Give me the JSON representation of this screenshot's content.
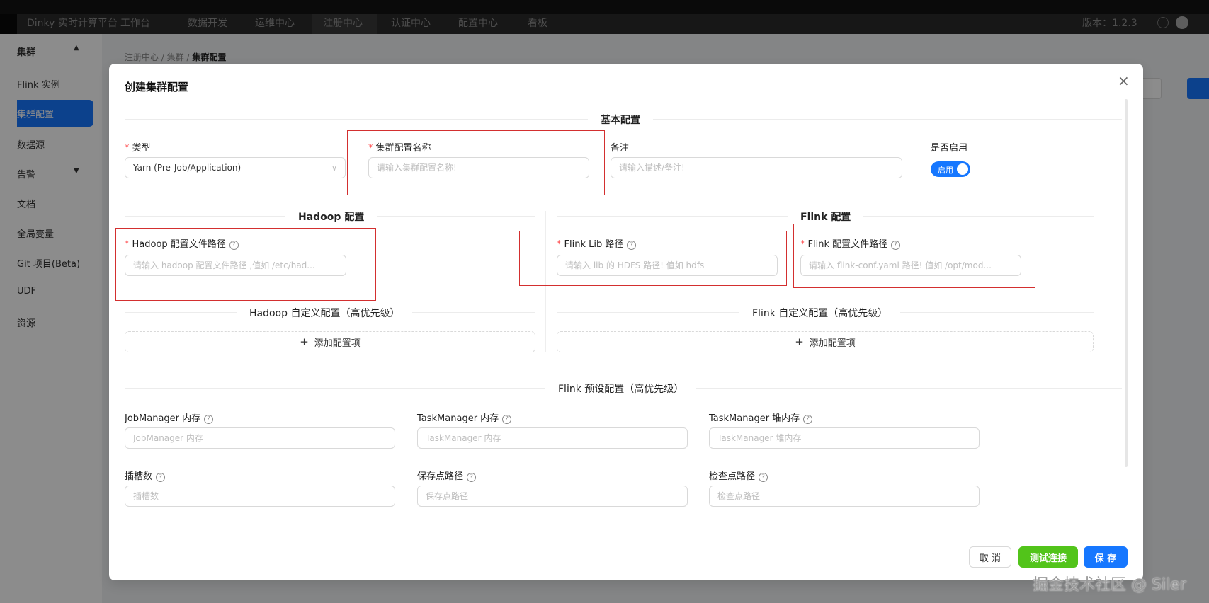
{
  "app": {
    "title": "Dinky 实时计算平台",
    "nav": [
      "工作台",
      "数据开发",
      "运维中心",
      "注册中心",
      "认证中心",
      "配置中心",
      "看板"
    ],
    "active_nav": "注册中心",
    "version": "版本：1.2.3"
  },
  "sidebar": {
    "group": "集群",
    "items": [
      "Flink 实例",
      "集群配置",
      "数据源",
      "告警",
      "文档",
      "全局变量",
      "Git 项目(Beta)",
      "UDF",
      "资源"
    ],
    "active": "集群配置"
  },
  "breadcrumb": [
    "注册中心",
    "集群",
    "集群配置"
  ],
  "modal": {
    "title": "创建集群配置",
    "sections": {
      "basic": "基本配置",
      "hadoop": "Hadoop 配置",
      "flink": "Flink 配置",
      "hadoop_custom": "Hadoop 自定义配置（高优先级）",
      "flink_custom": "Flink 自定义配置（高优先级）",
      "flink_preset": "Flink 预设配置（高优先级）"
    },
    "basic": {
      "type_label": "类型",
      "type_value_prefix": "Yarn (",
      "type_value_strike": "Pre-Job",
      "type_value_suffix": "/Application)",
      "name_label": "集群配置名称",
      "name_placeholder": "请输入集群配置名称!",
      "note_label": "备注",
      "note_placeholder": "请输入描述/备注!",
      "enabled_label": "是否启用",
      "enabled_text": "启用",
      "enabled": true
    },
    "hadoop": {
      "conf_label": "Hadoop 配置文件路径",
      "conf_placeholder": "请输入 hadoop 配置文件路径 ,值如 /etc/had...",
      "add_item": "添加配置项"
    },
    "flink": {
      "lib_label": "Flink Lib 路径",
      "lib_placeholder": "请输入 lib 的 HDFS 路径! 值如 hdfs",
      "conf_label": "Flink 配置文件路径",
      "conf_placeholder": "请输入 flink-conf.yaml 路径! 值如 /opt/mod...",
      "add_item": "添加配置项"
    },
    "preset": {
      "jm_label": "JobManager 内存",
      "jm_placeholder": "JobManager 内存",
      "tm_label": "TaskManager 内存",
      "tm_placeholder": "TaskManager 内存",
      "tm_heap_label": "TaskManager 堆内存",
      "tm_heap_placeholder": "TaskManager 堆内存",
      "slots_label": "插槽数",
      "slots_placeholder": "插槽数",
      "savepoint_label": "保存点路径",
      "savepoint_placeholder": "保存点路径",
      "checkpoint_label": "检查点路径",
      "checkpoint_placeholder": "检查点路径"
    },
    "buttons": {
      "cancel": "取 消",
      "test": "测试连接",
      "save": "保 存"
    }
  },
  "watermark": "掘金技术社区 @ Siler",
  "colors": {
    "primary": "#1677ff",
    "test_button": "#52c41a",
    "highlight_box": "#d32f2f",
    "required": "#ff4d4f"
  },
  "icons": [
    "close-icon",
    "search-icon",
    "chevron-down-icon",
    "chevron-up-icon",
    "plus-icon",
    "help-icon",
    "globe-icon"
  ]
}
